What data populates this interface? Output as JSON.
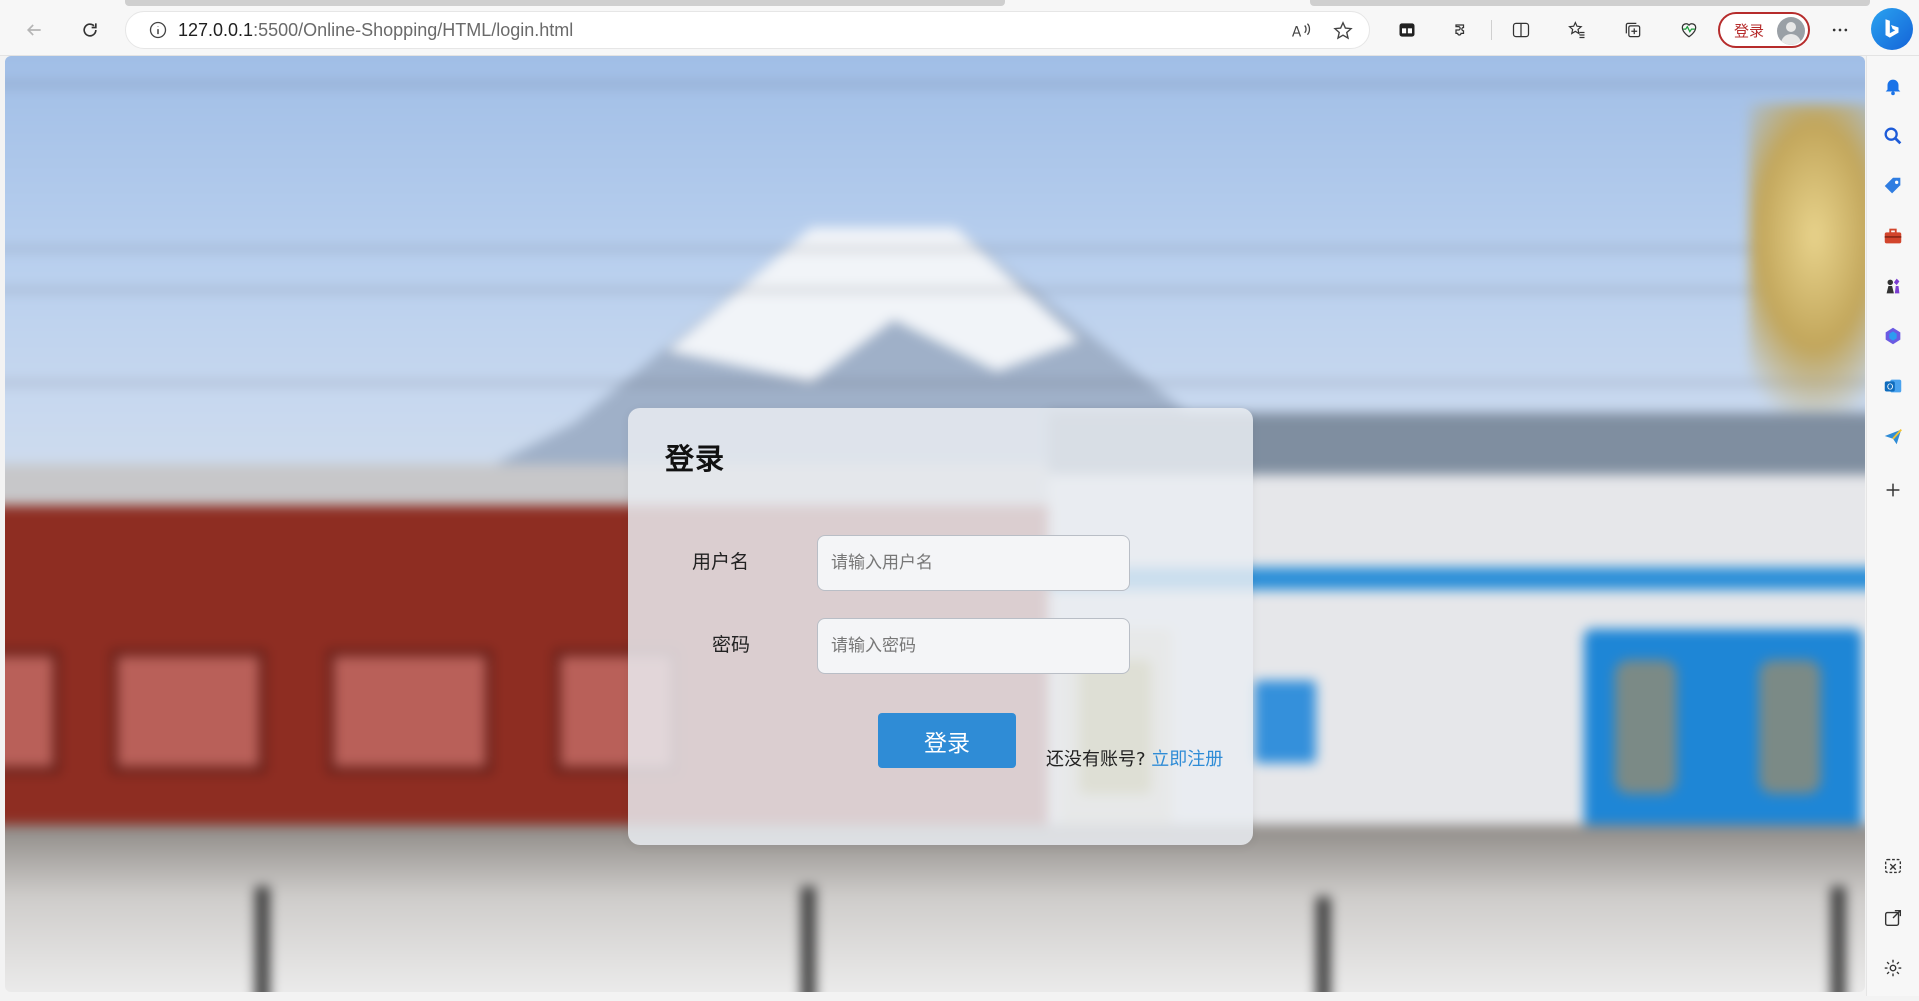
{
  "browser": {
    "url_host": "127.0.0.1",
    "url_rest": ":5500/Online-Shopping/HTML/login.html",
    "profile_label": "登录",
    "icons": {
      "back": "arrow-left-icon",
      "refresh": "refresh-icon",
      "site_info": "info-icon",
      "read_aloud": "read-aloud-icon",
      "favorite": "star-icon",
      "extensions": "puzzle-icon",
      "split_screen": "split-screen-icon",
      "favorites": "favorites-icon",
      "collections": "collections-icon",
      "performance": "heart-pulse-icon",
      "more": "more-icon",
      "copilot": "bing-icon"
    }
  },
  "sidebar": {
    "items": [
      "bell-icon",
      "search-icon",
      "shopping-tag-icon",
      "toolbox-icon",
      "chess-icon",
      "m365-icon",
      "outlook-icon",
      "send-icon",
      "add-icon"
    ],
    "bottom": [
      "screenshot-icon",
      "open-external-icon",
      "settings-icon"
    ]
  },
  "login": {
    "title": "登录",
    "username_label": "用户名",
    "username_placeholder": "请输入用户名",
    "password_label": "密码",
    "password_placeholder": "请输入密码",
    "submit_label": "登录",
    "no_account_text": "还没有账号?",
    "register_link": "立即注册"
  },
  "colors": {
    "primary_button": "#2f8cd6",
    "link": "#2f8cd6",
    "profile_accent": "#b62c2c"
  }
}
